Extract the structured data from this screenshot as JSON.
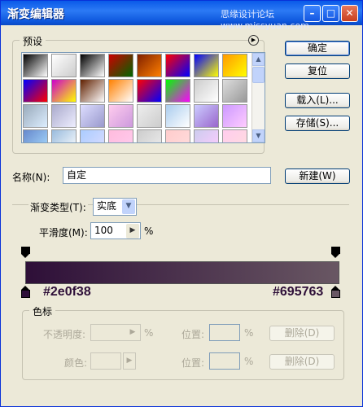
{
  "window": {
    "title": "渐变编辑器",
    "watermark": "思缘设计论坛 www.missyuan.com",
    "accent": "#0a5ae8"
  },
  "presets": {
    "title": "预设",
    "swatch_rows": [
      [
        [
          "#000",
          "#fff"
        ],
        [
          "#fff",
          "#ccc"
        ],
        [
          "#000",
          "#fff"
        ],
        [
          "#c00",
          "#060"
        ],
        [
          "#802000",
          "#ff8000"
        ],
        [
          "#f00",
          "#00f"
        ],
        [
          "#00f",
          "#ff0"
        ],
        [
          "#f90",
          "#ff0"
        ]
      ],
      [
        [
          "#00f",
          "#f00"
        ],
        [
          "#c0c",
          "#ff0"
        ],
        [
          "#602000",
          "#fff"
        ],
        [
          "#ff8000",
          "#fff"
        ],
        [
          "#f00",
          "#00f"
        ],
        [
          "#0f0",
          "#f0f"
        ],
        [
          "#ccc",
          "#fff"
        ],
        [
          "#ddd",
          "#999"
        ]
      ],
      [
        [
          "#9ab",
          "#def"
        ],
        [
          "#aac",
          "#eef"
        ],
        [
          "#ddf",
          "#99c"
        ],
        [
          "#fce",
          "#c9d"
        ],
        [
          "#eee",
          "#ccc"
        ],
        [
          "#ace",
          "#fff"
        ],
        [
          "#ccf",
          "#96c"
        ],
        [
          "#c9f",
          "#fcf"
        ]
      ],
      [
        [
          "#68c",
          "#adf"
        ],
        [
          "#9bd",
          "#fff"
        ],
        [
          "#acf",
          "#ddf"
        ],
        [
          "#fbd",
          "#fce"
        ],
        [
          "#ccc",
          "#eee"
        ],
        [
          "#fcc",
          "#fdd"
        ],
        [
          "#cce",
          "#fcf"
        ],
        [
          "#fce",
          "#fdd"
        ]
      ]
    ]
  },
  "buttons": {
    "ok": "确定",
    "reset": "复位",
    "load": "载入(L)...",
    "save": "存储(S)...",
    "new": "新建(W)",
    "delete1": "删除(D)",
    "delete2": "删除(D)"
  },
  "name": {
    "label": "名称(N):",
    "value": "自定"
  },
  "gradient": {
    "type_label": "渐变类型(T):",
    "type_value": "实底",
    "smooth_label": "平滑度(M):",
    "smooth_value": "100",
    "smooth_unit": "%",
    "color_left": "#2e0f38",
    "color_right": "#695763"
  },
  "color_stops": {
    "title": "色标",
    "opacity_label": "不透明度:",
    "opacity_unit": "%",
    "location_label1": "位置:",
    "location_unit1": "%",
    "color_label": "颜色:",
    "location_label2": "位置:",
    "location_unit2": "%"
  }
}
